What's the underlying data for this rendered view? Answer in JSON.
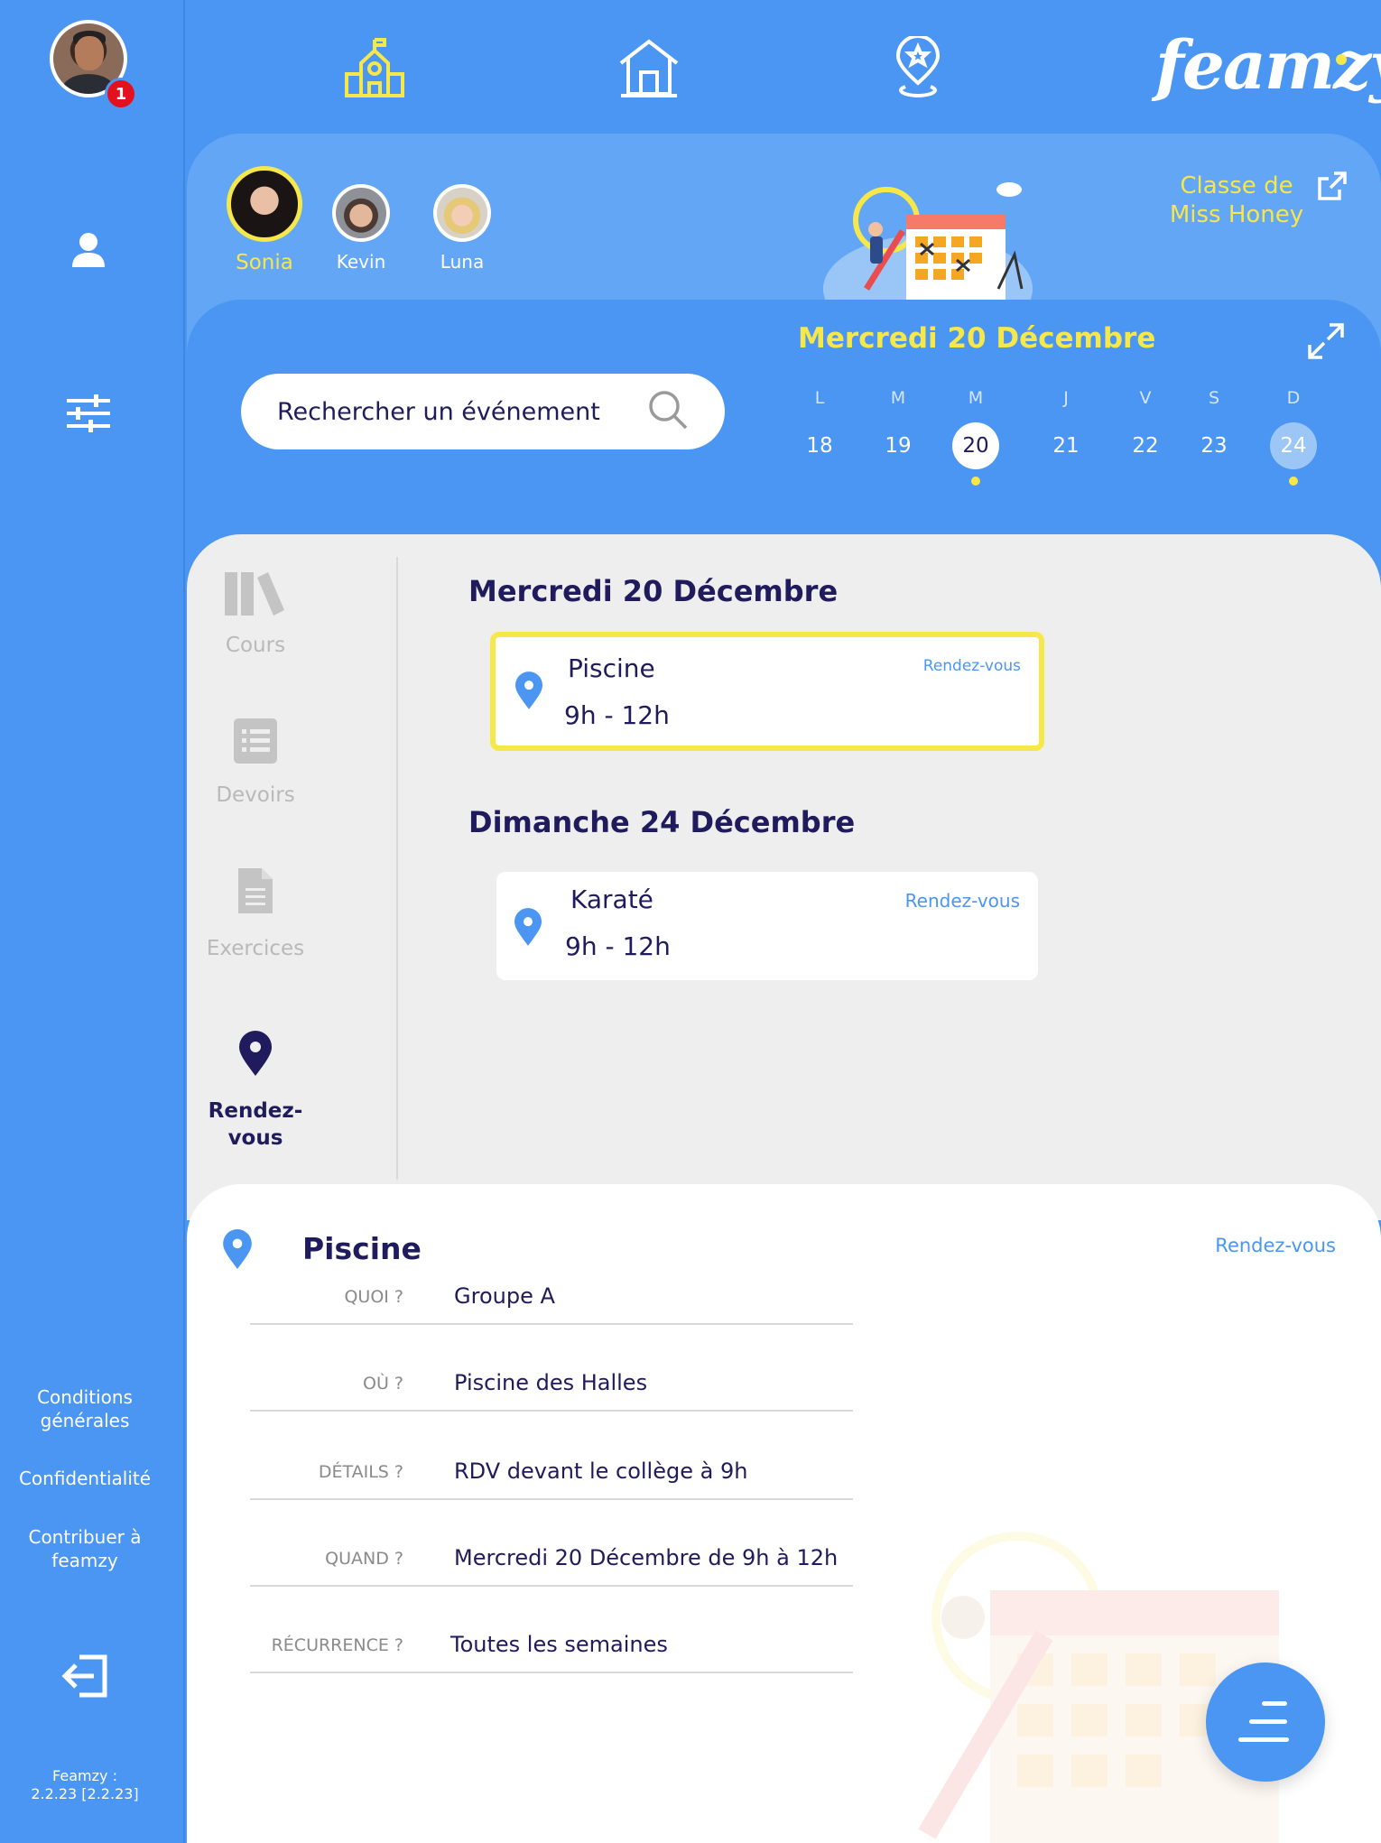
{
  "app": {
    "name": "feamzy"
  },
  "colors": {
    "primary": "#4a96f2",
    "accent": "#f6e74a",
    "text": "#1f1b5c",
    "badge": "#e4101e"
  },
  "sidebar": {
    "notification_count": "1",
    "links": {
      "terms": "Conditions générales",
      "privacy": "Confidentialité",
      "contribute": "Contribuer à feamzy"
    },
    "version_label": "Feamzy :",
    "version_value": "2.2.23 [2.2.23]",
    "icons": [
      "user-icon",
      "filter-sliders-icon",
      "logout-icon"
    ]
  },
  "topbar": {
    "icons": [
      "school-icon",
      "home-icon",
      "location-star-icon"
    ]
  },
  "children": [
    {
      "name": "Sonia",
      "selected": true
    },
    {
      "name": "Kevin",
      "selected": false
    },
    {
      "name": "Luna",
      "selected": false
    }
  ],
  "class_link": {
    "line1": "Classe de",
    "line2": "Miss Honey"
  },
  "calendar": {
    "title": "Mercredi 20 Décembre",
    "days": [
      {
        "letter": "L",
        "num": "18"
      },
      {
        "letter": "M",
        "num": "19"
      },
      {
        "letter": "M",
        "num": "20"
      },
      {
        "letter": "J",
        "num": "21"
      },
      {
        "letter": "V",
        "num": "22"
      },
      {
        "letter": "S",
        "num": "23"
      },
      {
        "letter": "D",
        "num": "24"
      }
    ]
  },
  "search": {
    "placeholder": "Rechercher un événement"
  },
  "categories": [
    {
      "label": "Cours"
    },
    {
      "label": "Devoirs"
    },
    {
      "label": "Exercices"
    },
    {
      "label": "Rendez-vous"
    }
  ],
  "events": [
    {
      "date_heading": "Mercredi 20 Décembre",
      "title": "Piscine",
      "time": "9h - 12h",
      "type": "Rendez-vous"
    },
    {
      "date_heading": "Dimanche 24 Décembre",
      "title": "Karaté",
      "time": "9h - 12h",
      "type": "Rendez-vous"
    }
  ],
  "detail": {
    "title": "Piscine",
    "type": "Rendez-vous",
    "rows": [
      {
        "label": "QUOI ?",
        "value": "Groupe A"
      },
      {
        "label": "OÙ ?",
        "value": "Piscine des Halles"
      },
      {
        "label": "DÉTAILS ?",
        "value": "RDV devant le collège à 9h"
      },
      {
        "label": "QUAND ?",
        "value": "Mercredi 20 Décembre de 9h à 12h"
      },
      {
        "label": "RÉCURRENCE ?",
        "value": "Toutes les semaines"
      }
    ]
  }
}
